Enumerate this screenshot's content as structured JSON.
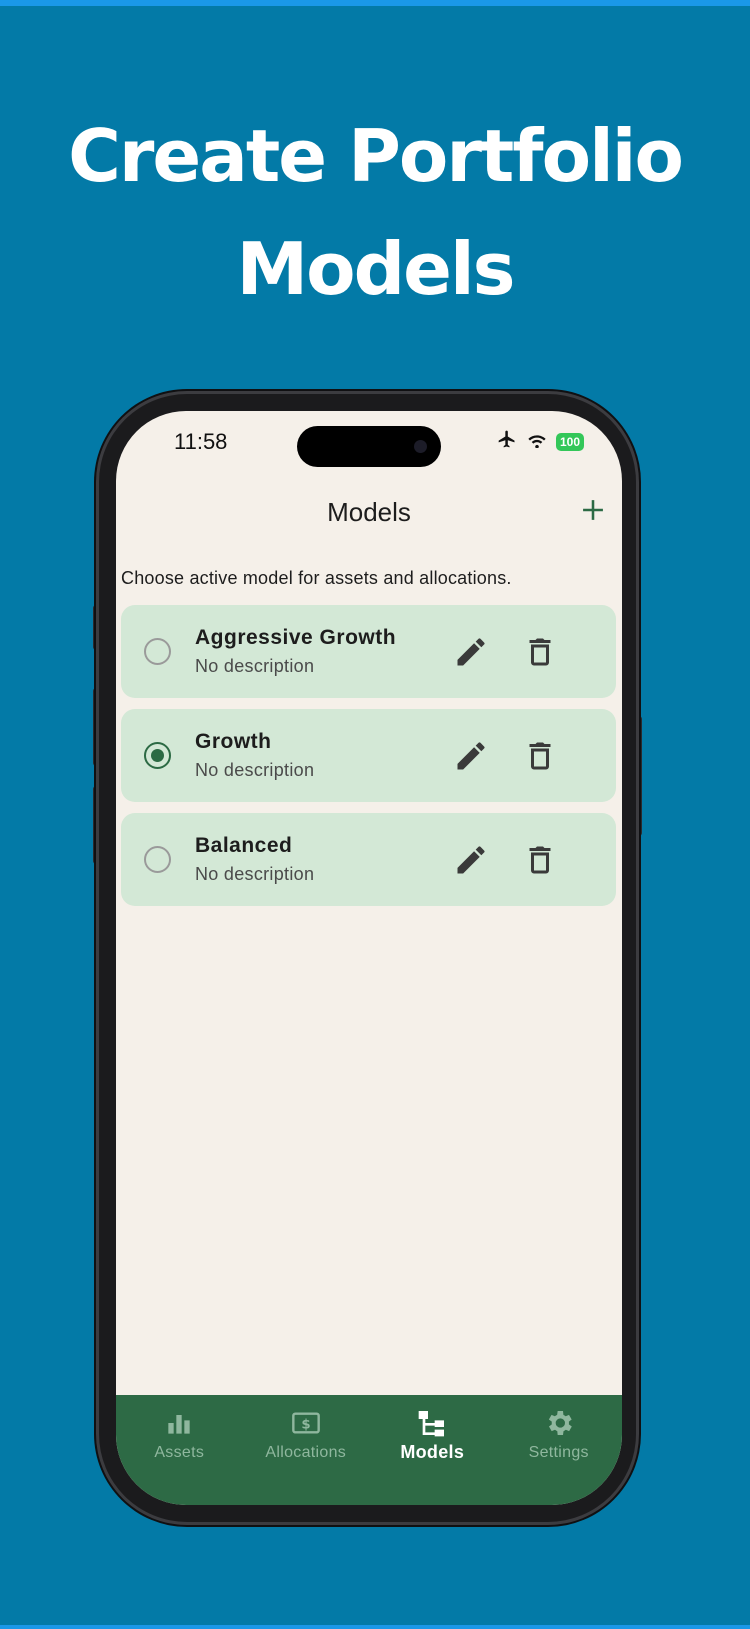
{
  "headline": {
    "line1": "Create Portfolio",
    "line2": "Models"
  },
  "status_bar": {
    "time": "11:58",
    "battery": "100",
    "icons": [
      "airplane-icon",
      "wifi-icon",
      "battery-icon"
    ]
  },
  "nav": {
    "title": "Models",
    "add_label": "+"
  },
  "hint": "Choose active model for assets and allocations.",
  "models": [
    {
      "name": "Aggressive Growth",
      "description": "No description",
      "selected": false
    },
    {
      "name": "Growth",
      "description": "No description",
      "selected": true
    },
    {
      "name": "Balanced",
      "description": "No description",
      "selected": false
    }
  ],
  "tabs": [
    {
      "label": "Assets",
      "icon": "bar-chart-icon",
      "active": false
    },
    {
      "label": "Allocations",
      "icon": "money-icon",
      "active": false
    },
    {
      "label": "Models",
      "icon": "hierarchy-icon",
      "active": true
    },
    {
      "label": "Settings",
      "icon": "gear-icon",
      "active": false
    }
  ],
  "colors": {
    "background": "#037aa7",
    "screen": "#f5f0e9",
    "card": "#d3e8d6",
    "accent": "#2c6a44",
    "tab_bar": "#2d6a45",
    "tab_inactive": "#8fb79e"
  }
}
